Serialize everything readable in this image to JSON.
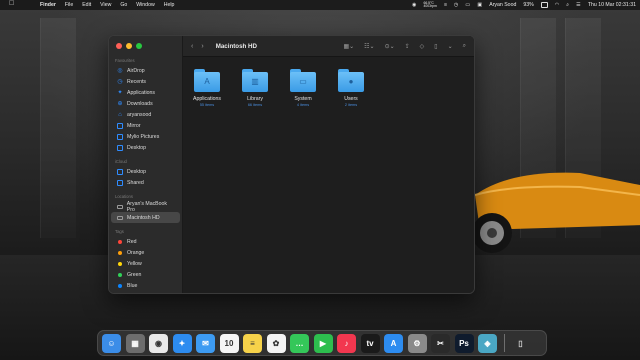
{
  "menubar": {
    "app_name": "Finder",
    "menus": [
      "File",
      "Edit",
      "View",
      "Go",
      "Window",
      "Help"
    ],
    "temp_line1": "66.5°C",
    "temp_line2": "4003rpm",
    "user": "Aryan Sood",
    "battery": "93%",
    "datetime": "Thu 10 Mar  02:31:31"
  },
  "finder": {
    "title": "Macintosh HD",
    "sidebar": {
      "favourites_label": "Favourites",
      "favourites": [
        "AirDrop",
        "Recents",
        "Applications",
        "Downloads",
        "aryansood",
        "Mirror",
        "Mylio Pictures",
        "Desktop"
      ],
      "icloud_label": "iCloud",
      "icloud": [
        "Desktop",
        "Shared"
      ],
      "locations_label": "Locations",
      "locations": [
        "Aryan's MacBook Pro",
        "Macintosh HD"
      ],
      "tags_label": "Tags",
      "tags": [
        {
          "name": "Red",
          "color": "#ff453a"
        },
        {
          "name": "Orange",
          "color": "#ff9f0a"
        },
        {
          "name": "Yellow",
          "color": "#ffd60a"
        },
        {
          "name": "Green",
          "color": "#30d158"
        },
        {
          "name": "Blue",
          "color": "#0a84ff"
        }
      ]
    },
    "items": [
      {
        "name": "Applications",
        "sub": "55 items",
        "glyph": "A"
      },
      {
        "name": "Library",
        "sub": "66 items",
        "glyph": "▥"
      },
      {
        "name": "System",
        "sub": "4 items",
        "glyph": "▭"
      },
      {
        "name": "Users",
        "sub": "2 items",
        "glyph": "●"
      }
    ]
  },
  "dock": {
    "apps": [
      {
        "name": "finder-icon",
        "color": "#3b8de8",
        "glyph": "☺"
      },
      {
        "name": "launchpad-icon",
        "color": "#6d6d6d",
        "glyph": "▦"
      },
      {
        "name": "chrome-icon",
        "color": "#e9e9e9",
        "glyph": "◉"
      },
      {
        "name": "safari-icon",
        "color": "#2d8cf0",
        "glyph": "✦"
      },
      {
        "name": "mail-icon",
        "color": "#3d9bf2",
        "glyph": "✉"
      },
      {
        "name": "calendar-icon",
        "color": "#f5f5f5",
        "glyph": "10"
      },
      {
        "name": "notes-icon",
        "color": "#f6d24a",
        "glyph": "≡"
      },
      {
        "name": "photos-icon",
        "color": "#f3f3f3",
        "glyph": "✿"
      },
      {
        "name": "messages-icon",
        "color": "#34c759",
        "glyph": "…"
      },
      {
        "name": "facetime-icon",
        "color": "#2dbe4e",
        "glyph": "▶"
      },
      {
        "name": "music-icon",
        "color": "#f2374f",
        "glyph": "♪"
      },
      {
        "name": "appletv-icon",
        "color": "#1a1a1a",
        "glyph": "tv"
      },
      {
        "name": "appstore-icon",
        "color": "#2d8cf0",
        "glyph": "A"
      },
      {
        "name": "settings-icon",
        "color": "#8a8a8a",
        "glyph": "⚙"
      },
      {
        "name": "finalcut-icon",
        "color": "#2a2a2a",
        "glyph": "✂"
      },
      {
        "name": "photoshop-icon",
        "color": "#0f1b2d",
        "glyph": "Ps"
      },
      {
        "name": "cleanmymac-icon",
        "color": "#4aa7c4",
        "glyph": "◈"
      }
    ],
    "trash": {
      "name": "trash-icon",
      "color": "#9a9a9a",
      "glyph": "🗑"
    }
  }
}
